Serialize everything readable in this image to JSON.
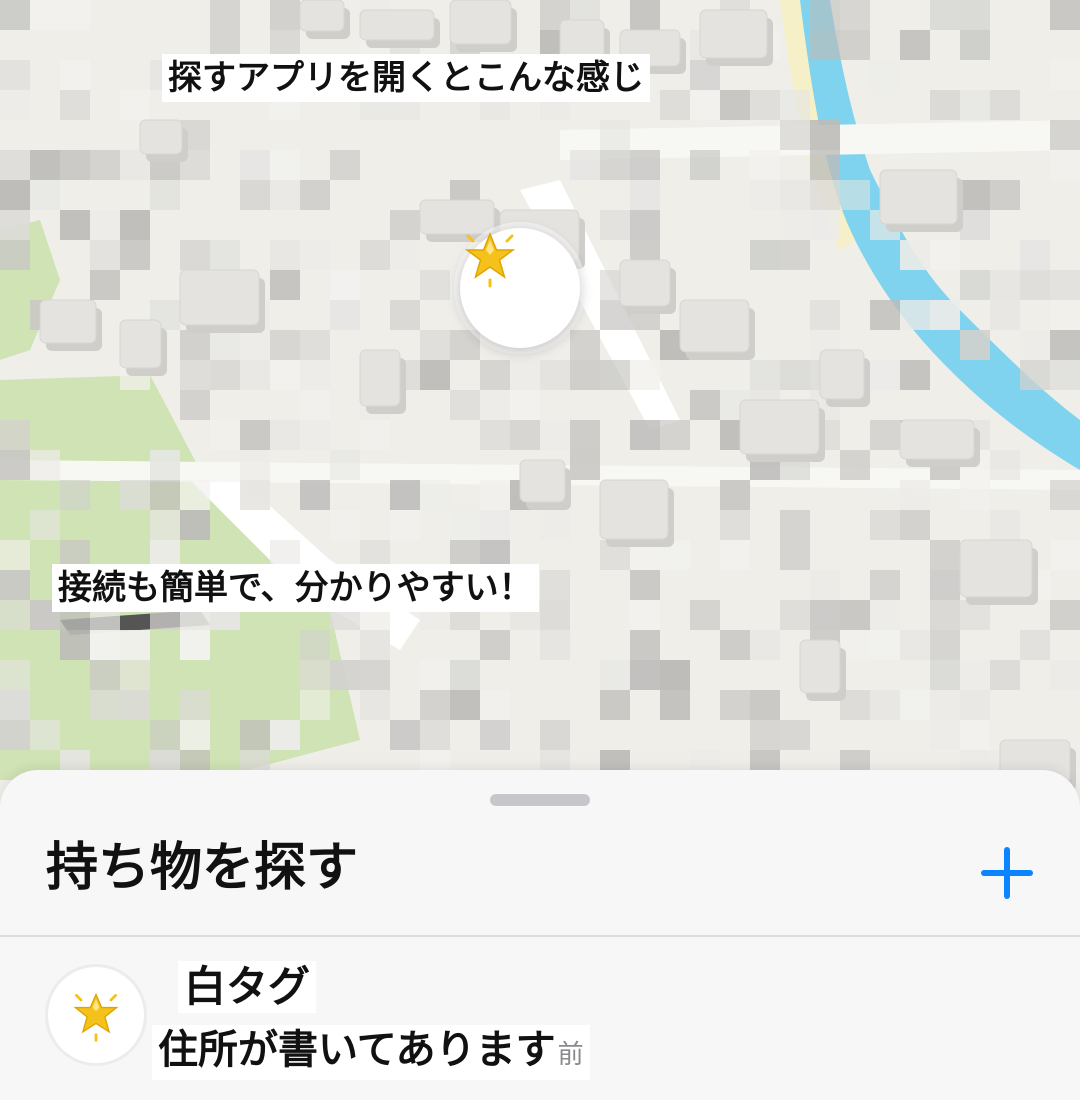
{
  "map": {
    "caption_top": "探すアプリを開くとこんな感じ",
    "caption_mid": "接続も簡単で、分かりやすい！",
    "pin_icon": "star-icon",
    "colors": {
      "land": "#efeee9",
      "park": "#cfe3b4",
      "water": "#7fd3ee",
      "road": "#ffffff",
      "building": "#dddcd8",
      "shadow": "#cfcecb"
    }
  },
  "sheet": {
    "title": "持ち物を探す",
    "add_label": "+",
    "items": [
      {
        "icon": "star-icon",
        "name": "白タグ",
        "subtitle": "住所が書いてあります",
        "subtitle_tail": "前"
      }
    ]
  },
  "colors": {
    "accent": "#0a84ff",
    "star": "#f5c21b"
  }
}
